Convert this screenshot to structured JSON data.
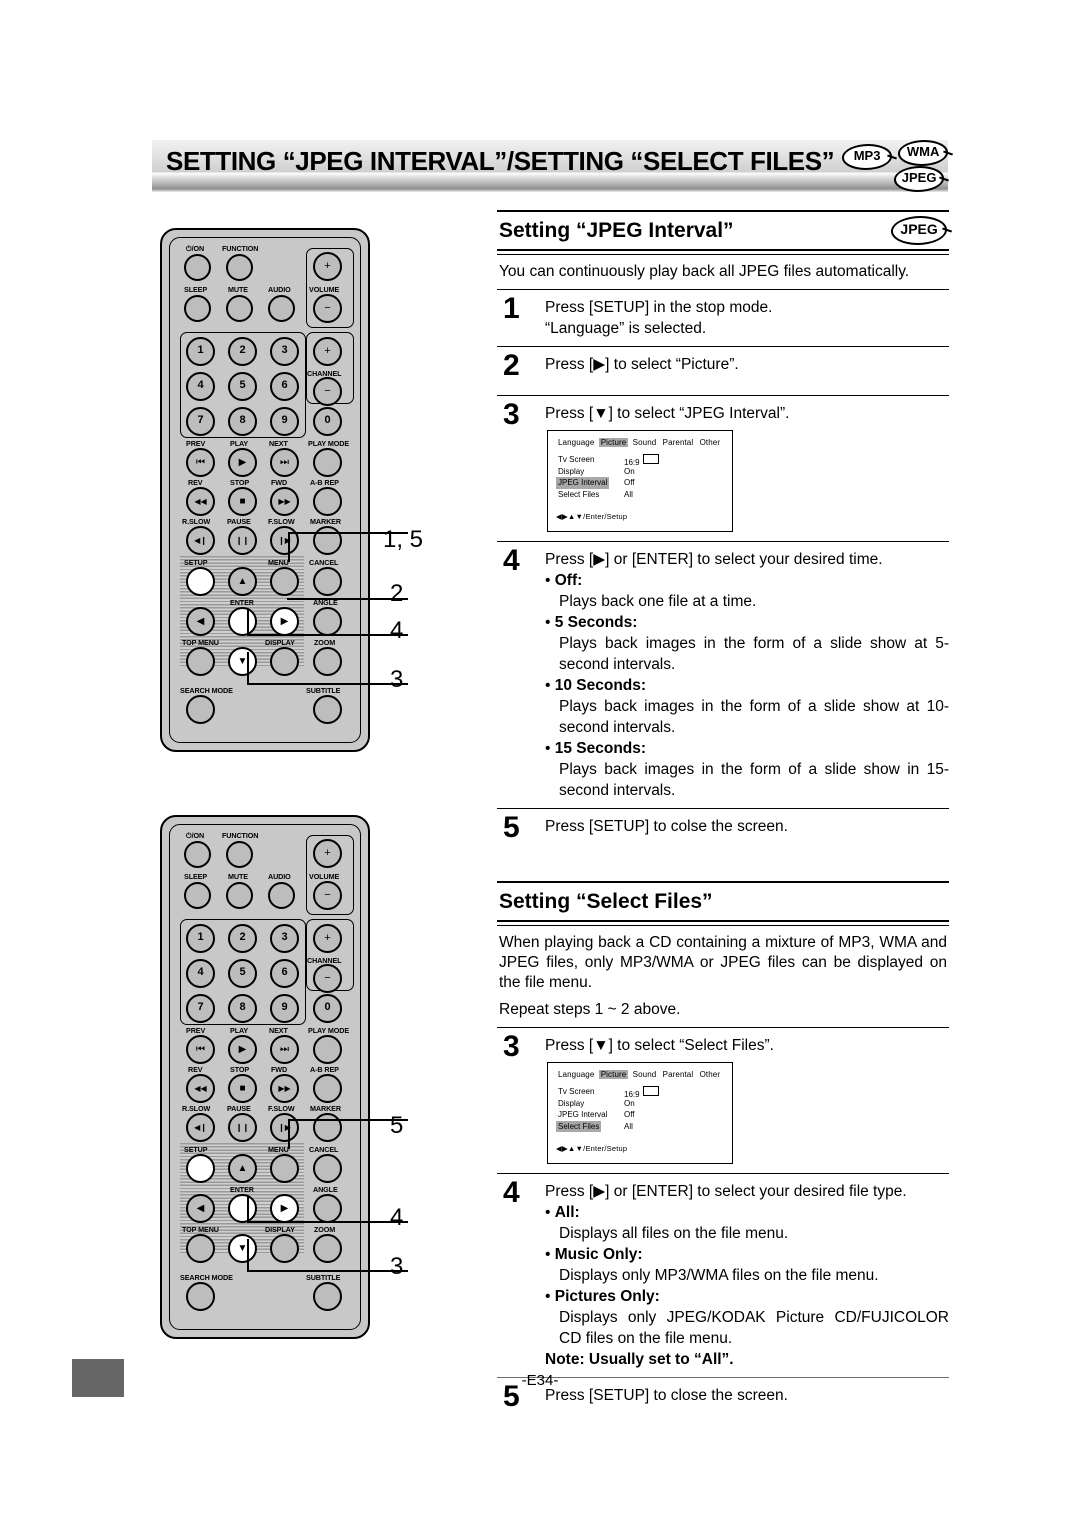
{
  "header": {
    "title": "SETTING “JPEG INTERVAL”/SETTING “SELECT FILES”",
    "discs": [
      "MP3",
      "WMA",
      "JPEG"
    ]
  },
  "section_jpeg": {
    "heading": "Setting “JPEG Interval”",
    "disc_badge": "JPEG",
    "intro": "You can continuously play back all JPEG files automatically.",
    "steps": [
      {
        "num": "1",
        "lines": [
          "Press [SETUP] in the stop mode.",
          "“Language” is selected."
        ]
      },
      {
        "num": "2",
        "lines": [
          "Press [▶] to select “Picture”."
        ]
      },
      {
        "num": "3",
        "lines": [
          "Press [▼] to select “JPEG Interval”."
        ]
      },
      {
        "num": "4",
        "lines": [
          "Press [▶] or [ENTER] to select your desired time."
        ],
        "bullets": [
          {
            "label": "Off:",
            "desc": "Plays back one file at a time."
          },
          {
            "label": "5 Seconds:",
            "desc": "Plays back images in the form of a slide show at 5-second intervals."
          },
          {
            "label": "10 Seconds:",
            "desc": "Plays back images in the form of a slide show at 10-second intervals."
          },
          {
            "label": "15 Seconds:",
            "desc": "Plays back images in the form of a slide show in 15-second intervals."
          }
        ]
      },
      {
        "num": "5",
        "lines": [
          "Press [SETUP] to colse the screen."
        ]
      }
    ]
  },
  "section_select": {
    "heading": "Setting “Select Files”",
    "intro": "When playing back a CD containing a mixture of MP3, WMA and JPEG files, only MP3/WMA or JPEG files can be displayed on the file menu.",
    "repeat_note": "Repeat steps 1 ~ 2 above.",
    "steps": [
      {
        "num": "3",
        "lines": [
          "Press [▼] to select “Select Files”."
        ]
      },
      {
        "num": "4",
        "lines": [
          "Press [▶] or [ENTER] to select your desired file type."
        ],
        "bullets": [
          {
            "label": "All:",
            "desc": "Displays all files on the file menu."
          },
          {
            "label": "Music Only:",
            "desc": "Displays only MP3/WMA files on the file menu."
          },
          {
            "label": "Pictures Only:",
            "desc": "Displays only JPEG/KODAK Picture CD/FUJICOLOR CD files on the file menu."
          }
        ],
        "note": "Note: Usually set to “All”."
      },
      {
        "num": "5",
        "lines": [
          "Press [SETUP] to close the screen."
        ]
      }
    ]
  },
  "osd_jpeg": {
    "tabs": [
      "Language",
      "Picture",
      "Sound",
      "Parental",
      "Other"
    ],
    "selected_tab": "Picture",
    "rows": [
      {
        "label": "Tv Screen",
        "value": "16:9"
      },
      {
        "label": "Display",
        "value": "On"
      },
      {
        "label": "JPEG Interval",
        "value": "Off"
      },
      {
        "label": "Select Files",
        "value": "All"
      }
    ],
    "selected_row": "JPEG Interval",
    "nav_hint": "◀▶▲▼/Enter/Setup"
  },
  "osd_select": {
    "tabs": [
      "Language",
      "Picture",
      "Sound",
      "Parental",
      "Other"
    ],
    "selected_tab": "Picture",
    "rows": [
      {
        "label": "Tv Screen",
        "value": "16:9"
      },
      {
        "label": "Display",
        "value": "On"
      },
      {
        "label": "JPEG Interval",
        "value": "Off"
      },
      {
        "label": "Select Files",
        "value": "All"
      }
    ],
    "selected_row": "Select Files",
    "nav_hint": "◀▶▲▼/Enter/Setup"
  },
  "remote": {
    "labels": {
      "power": "⏻/ON",
      "function": "FUNCTION",
      "sleep": "SLEEP",
      "mute": "MUTE",
      "audio": "AUDIO",
      "volume": "VOLUME",
      "channel": "CHANNEL",
      "prev": "PREV",
      "play": "PLAY",
      "next": "NEXT",
      "play_mode": "PLAY MODE",
      "rev": "REV",
      "stop": "STOP",
      "fwd": "FWD",
      "ab_rep": "A-B REP",
      "r_slow": "R.SLOW",
      "pause": "PAUSE",
      "f_slow": "F.SLOW",
      "marker": "MARKER",
      "setup": "SETUP",
      "menu": "MENU",
      "cancel": "CANCEL",
      "enter": "ENTER",
      "angle": "ANGLE",
      "top_menu": "TOP MENU",
      "display": "DISPLAY",
      "zoom": "ZOOM",
      "search_mode": "SEARCH MODE",
      "subtitle": "SUBTITLE",
      "plus": "+",
      "minus": "−"
    },
    "numbers": [
      "1",
      "2",
      "3",
      "4",
      "5",
      "6",
      "7",
      "8",
      "9",
      "0"
    ],
    "glyphs": {
      "prev": "⏮",
      "play": "▶",
      "next": "⏭",
      "rev": "◀◀",
      "stop": "■",
      "fwd": "▶▶",
      "r_slow": "◀❙",
      "pause": "❙❙",
      "f_slow": "❙▶",
      "up": "▲",
      "down": "▼",
      "left": "◀",
      "right": "▶"
    }
  },
  "callouts_top": [
    "1, 5",
    "2",
    "4",
    "3"
  ],
  "callouts_bottom": [
    "5",
    "4",
    "3"
  ],
  "footer": {
    "page_number": "-E34-"
  }
}
